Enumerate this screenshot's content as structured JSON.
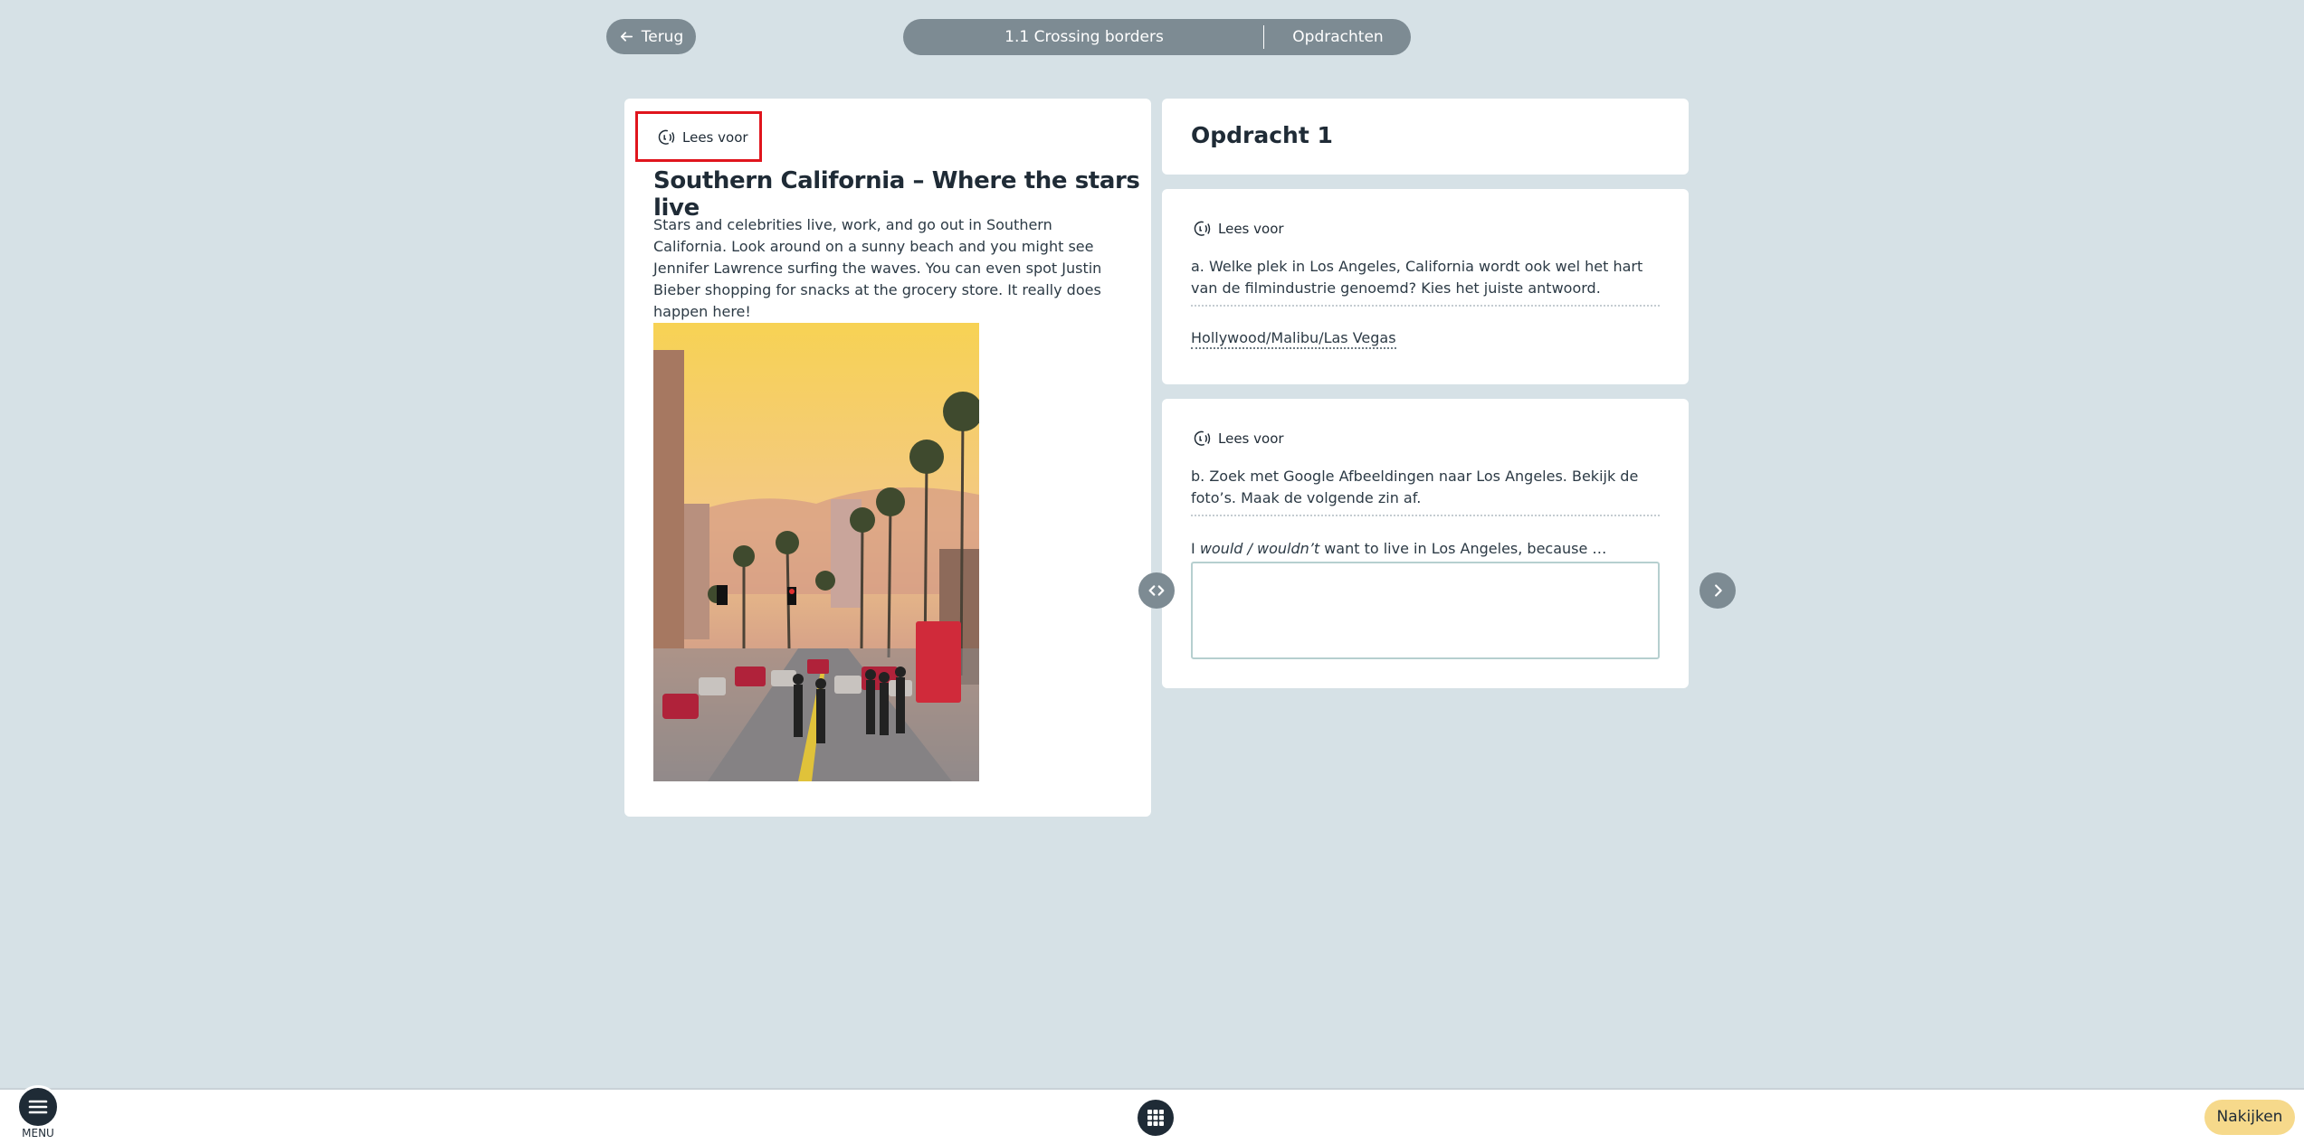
{
  "colors": {
    "page_background": "#d6e1e6",
    "pill": "#7d8b93",
    "dark": "#1f2b36",
    "highlight_border": "#e0151d",
    "check_button": "#f6d98b"
  },
  "header": {
    "back_label": "Terug",
    "back_icon": "arrow-left-icon",
    "section_title": "1.1 Crossing borders",
    "tab_label": "Opdrachten"
  },
  "article": {
    "read_aloud_label": "Lees voor",
    "read_aloud_icon": "speaker-icon",
    "title": "Southern California – Where the stars live",
    "body": "Stars and celebrities live, work, and go out in Southern California. Look around on a sunny beach and you might see Jennifer Lawrence surfing the waves. You can even spot Justin Bieber shopping for snacks at the grocery store. It really does happen here!",
    "photo_subject": "Hollywood boulevard street scene at sunset with palm trees"
  },
  "exercise": {
    "title": "Opdracht 1",
    "questions": [
      {
        "read_aloud_label": "Lees voor",
        "text": "a. Welke plek in Los Angeles, California wordt ook wel het hart van de filmindustrie genoemd? Kies het juiste antwoord.",
        "choice": "Hollywood/Malibu/Las Vegas"
      },
      {
        "read_aloud_label": "Lees voor",
        "text": "b. Zoek met Google Afbeeldingen naar Los Angeles. Bekijk de foto’s. Maak de volgende zin af.",
        "prompt_start": "I ",
        "prompt_italic": "would / wouldn’t",
        "prompt_end": " want to live in Los Angeles, because …",
        "answer_value": ""
      }
    ]
  },
  "footer": {
    "menu_label": "MENU",
    "check_label": "Nakijken",
    "grid_icon": "grid-icon"
  }
}
